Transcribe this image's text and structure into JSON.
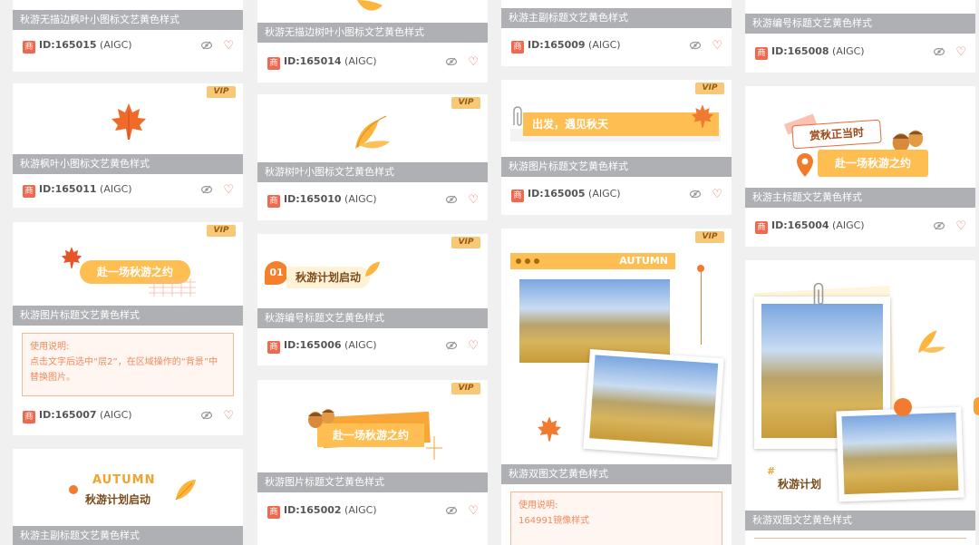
{
  "cards": [
    {
      "caption": "秋游无描边枫叶小图标文艺黄色样式",
      "shang": "商",
      "id": "ID:165015",
      "tag": "(AIGC)"
    },
    {
      "caption": "秋游枫叶小图标文艺黄色样式",
      "vip": "VIP",
      "shang": "商",
      "id": "ID:165011",
      "tag": "(AIGC)"
    },
    {
      "caption": "秋游图片标题文艺黄色样式",
      "vip": "VIP",
      "banner": "赴一场秋游之约",
      "notice_title": "使用说明:",
      "notice_body": "点击文字后选中“层2”，在区域操作的“背景”中替换图片。",
      "shang": "商",
      "id": "ID:165007",
      "tag": "(AIGC)"
    },
    {
      "caption": "秋游主副标题文艺黄色样式",
      "autumn": "AUTUMN",
      "sub": "秋游计划启动"
    },
    {
      "caption": "秋游无描边树叶小图标文艺黄色样式",
      "shang": "商",
      "id": "ID:165014",
      "tag": "(AIGC)"
    },
    {
      "caption": "秋游树叶小图标文艺黄色样式",
      "vip": "VIP",
      "shang": "商",
      "id": "ID:165010",
      "tag": "(AIGC)"
    },
    {
      "caption": "秋游编号标题文艺黄色样式",
      "vip": "VIP",
      "num": "01",
      "banner": "秋游计划启动",
      "shang": "商",
      "id": "ID:165006",
      "tag": "(AIGC)"
    },
    {
      "caption": "秋游图片标题文艺黄色样式",
      "vip": "VIP",
      "banner": "赴一场秋游之约",
      "shang": "商",
      "id": "ID:165002",
      "tag": "(AIGC)"
    },
    {
      "caption": "秋游主副标题文艺黄色样式",
      "shang": "商",
      "id": "ID:165009",
      "tag": "(AIGC)"
    },
    {
      "caption": "秋游图片标题文艺黄色样式",
      "vip": "VIP",
      "banner": "出发，遇见秋天",
      "shang": "商",
      "id": "ID:165005",
      "tag": "(AIGC)"
    },
    {
      "caption": "秋游双图文艺黄色样式",
      "vip": "VIP",
      "autumn": "AUTUMN",
      "notice_title": "使用说明:",
      "notice_body": "164991镜像样式"
    },
    {
      "caption": "秋游编号标题文艺黄色样式",
      "shang": "商",
      "id": "ID:165008",
      "tag": "(AIGC)"
    },
    {
      "caption": "秋游主标题文艺黄色样式",
      "tag1": "赏秋正当时",
      "banner": "赴一场秋游之约",
      "shang": "商",
      "id": "ID:165004",
      "tag": "(AIGC)"
    },
    {
      "caption": "秋游双图文艺黄色样式",
      "title": "秋游计划",
      "hash": "#"
    }
  ],
  "colors": {
    "accent": "#ffbe52",
    "heart": "#f06858",
    "badge": "#f0694f",
    "caption_bg": "#aeb0b4"
  }
}
